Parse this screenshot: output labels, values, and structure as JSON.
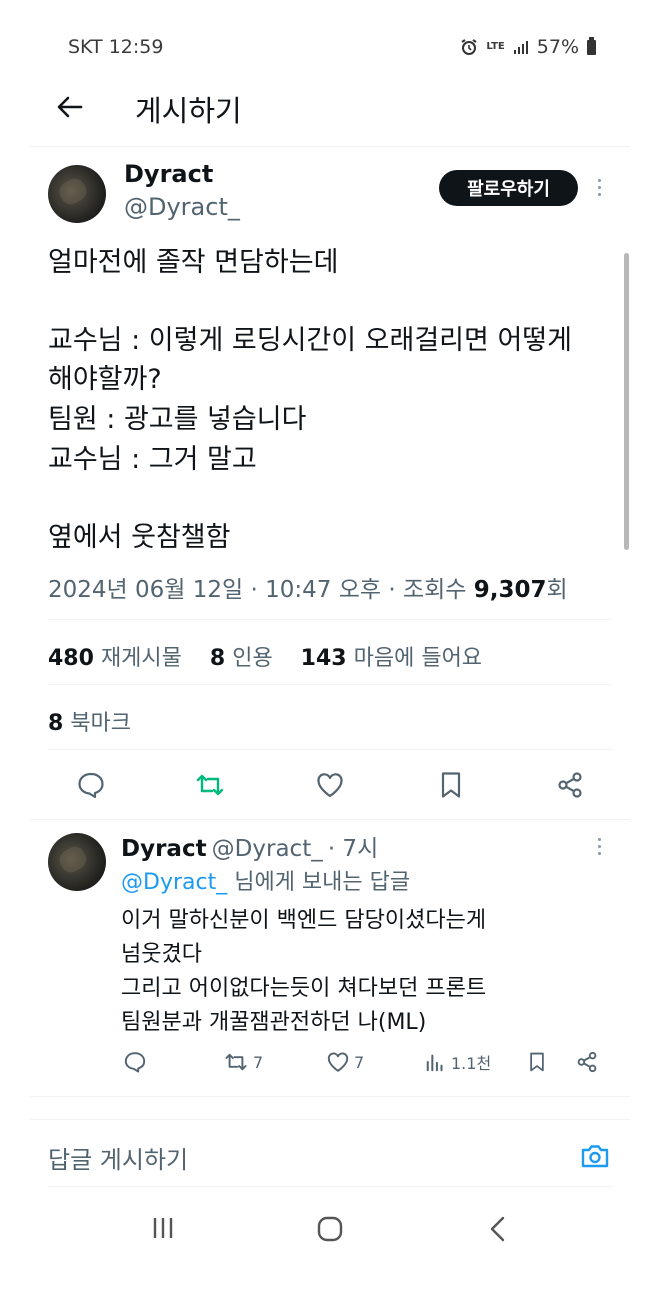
{
  "status_bar": {
    "carrier_time": "SKT 12:59",
    "network": "LTE",
    "battery": "57%",
    "icons": [
      "alarm-icon",
      "signal-icon",
      "battery-icon"
    ]
  },
  "header": {
    "title": "게시하기",
    "back_icon": "arrow-left-icon"
  },
  "post": {
    "author_name": "Dyract",
    "author_handle": "@Dyract_",
    "follow_label": "팔로우하기",
    "lines": [
      "얼마전에 졸작 면담하는데",
      "교수님 : 이렇게 로딩시간이 오래걸리면 어떻게",
      "해야할까?",
      "팀원 : 광고를 넣습니다",
      "교수님 : 그거 말고",
      "옆에서 웃참챌함"
    ],
    "meta_datetime": "2024년 06월 12일 · 10:47 오후 · 조회수 ",
    "meta_views": "9,307",
    "meta_views_suffix": "회",
    "retweets_count": "480",
    "retweets_label": "재게시물",
    "quotes_count": "8",
    "quotes_label": "인용",
    "likes_count": "143",
    "likes_label": "마음에 들어요",
    "bookmarks_count": "8",
    "bookmarks_label": "북마크"
  },
  "reply": {
    "author_name": "Dyract",
    "author_handle": "@Dyract_",
    "time": "· 7시",
    "replying_to_handle": "@Dyract_",
    "replying_to_suffix": "님에게 보내는 답글",
    "lines": [
      "이거 말하신분이 백엔드 담당이셨다는게",
      "넘웃겼다",
      "그리고 어이없다는듯이 쳐다보던 프론트",
      "팀원분과 개꿀잼관전하던 나(ML)"
    ],
    "retweet_count": "7",
    "like_count": "7",
    "views_count": "1.1천"
  },
  "compose": {
    "placeholder": "답글 게시하기"
  },
  "colors": {
    "accent": "#1d9bf0",
    "retweet_green": "#00ba7c",
    "text_primary": "#0f1419",
    "text_secondary": "#536471"
  }
}
